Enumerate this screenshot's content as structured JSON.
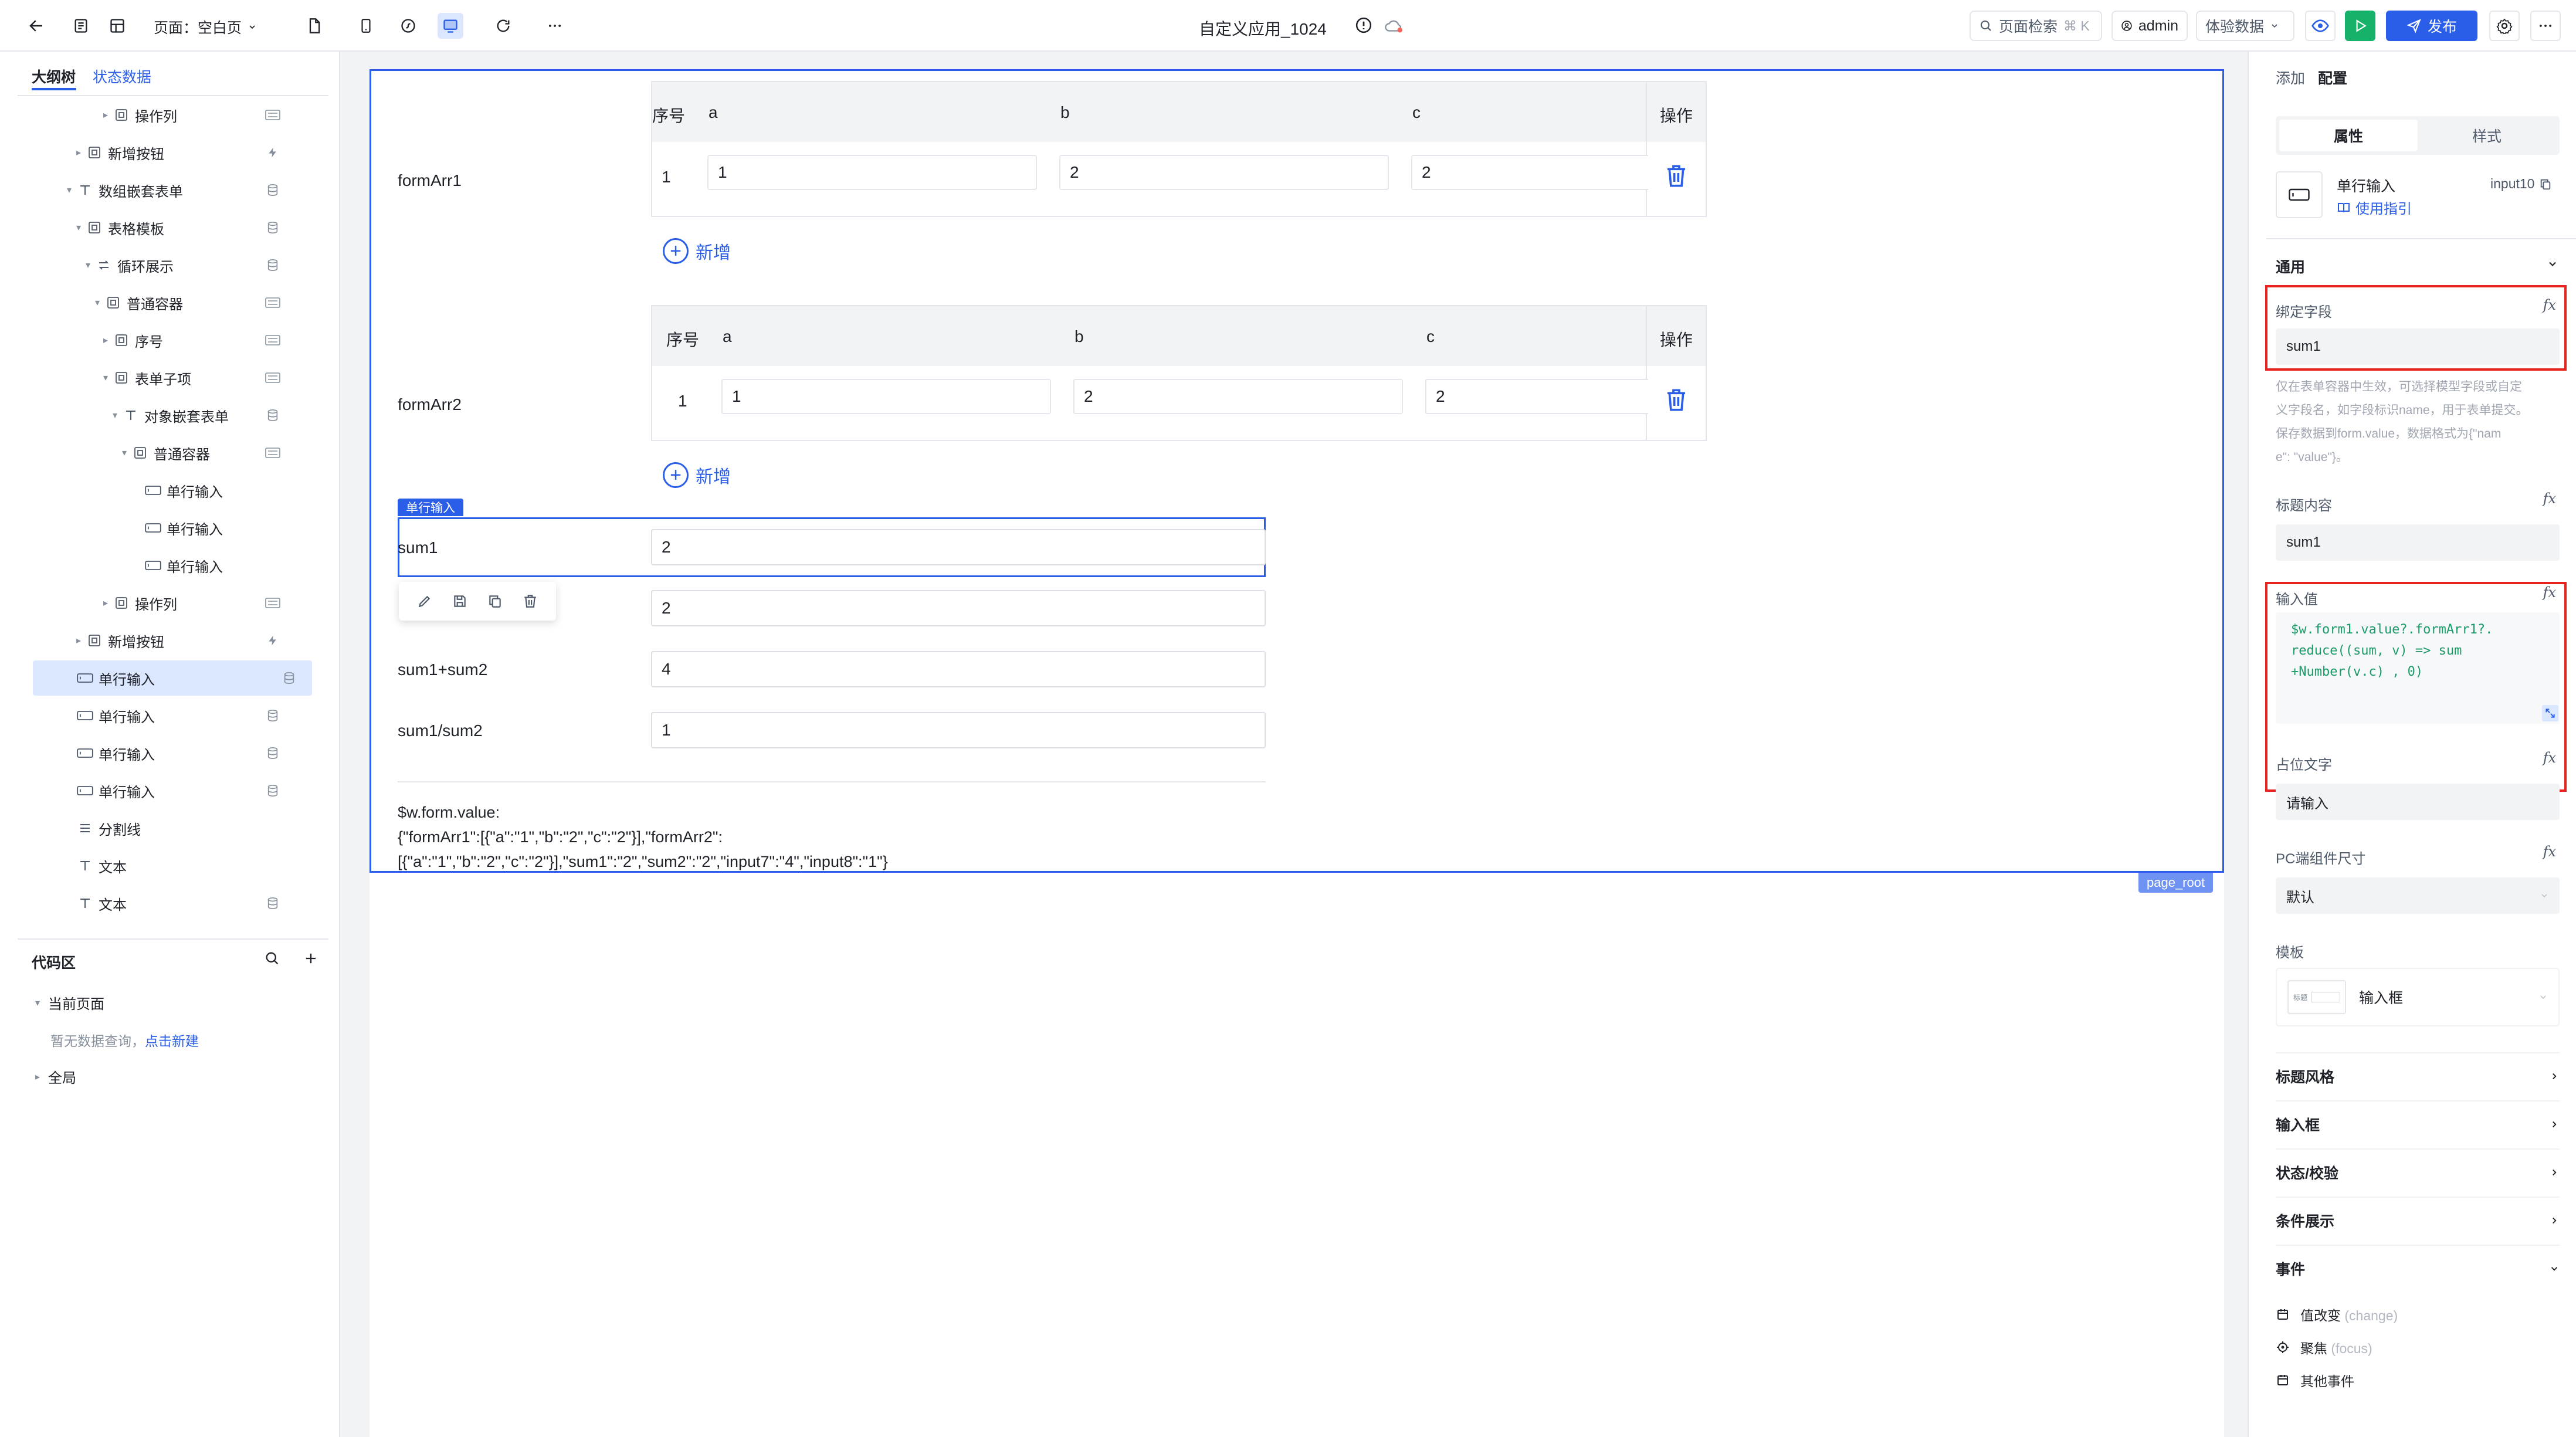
{
  "topbar": {
    "page_label": "页面：空白页",
    "app_title": "自定义应用_1024",
    "search": {
      "label": "页面检索",
      "shortcut": "⌘ K"
    },
    "user": "admin",
    "experience_data": "体验数据",
    "publish": "发布"
  },
  "left": {
    "tabs": [
      "大纲树",
      "状态数据"
    ],
    "tree": [
      {
        "label": "操作列"
      },
      {
        "label": "新增按钮"
      },
      {
        "label": "数组嵌套表单"
      },
      {
        "label": "表格模板"
      },
      {
        "label": "循环展示"
      },
      {
        "label": "普通容器"
      },
      {
        "label": "序号"
      },
      {
        "label": "表单子项"
      },
      {
        "label": "对象嵌套表单"
      },
      {
        "label": "普通容器"
      },
      {
        "label": "单行输入"
      },
      {
        "label": "单行输入"
      },
      {
        "label": "单行输入"
      },
      {
        "label": "操作列"
      },
      {
        "label": "新增按钮"
      },
      {
        "label": "单行输入"
      },
      {
        "label": "单行输入"
      },
      {
        "label": "单行输入"
      },
      {
        "label": "单行输入"
      },
      {
        "label": "分割线"
      },
      {
        "label": "文本"
      },
      {
        "label": "文本"
      }
    ],
    "code_area": {
      "title": "代码区",
      "current_page": "当前页面",
      "empty_hint": "暂无数据查询，",
      "create_link": "点击新建",
      "global": "全局"
    }
  },
  "canvas": {
    "page_tag": "page_root",
    "formArr1": {
      "label": "formArr1",
      "headers": [
        "序号",
        "a",
        "b",
        "c",
        "操作"
      ],
      "row": {
        "index": "1",
        "a": "1",
        "b": "2",
        "c": "2"
      },
      "add": "新增"
    },
    "formArr2": {
      "label": "formArr2",
      "headers": [
        "序号",
        "a",
        "b",
        "c",
        "操作"
      ],
      "row": {
        "index": "1",
        "a": "1",
        "b": "2",
        "c": "2"
      },
      "add": "新增"
    },
    "selected_tag": "单行输入",
    "fields": [
      {
        "label": "sum1",
        "value": "2"
      },
      {
        "label": "",
        "value": "2"
      },
      {
        "label": "sum1+sum2",
        "value": "4"
      },
      {
        "label": "sum1/sum2",
        "value": "1"
      }
    ],
    "form_value_title": "$w.form.value:",
    "form_value_line1": "{\"formArr1\":[{\"a\":\"1\",\"b\":\"2\",\"c\":\"2\"}],\"formArr2\":",
    "form_value_line2": "[{\"a\":\"1\",\"b\":\"2\",\"c\":\"2\"}],\"sum1\":\"2\",\"sum2\":\"2\",\"input7\":\"4\",\"input8\":\"1\"}"
  },
  "right": {
    "tabs": [
      "添加",
      "配置"
    ],
    "subtabs": [
      "属性",
      "样式"
    ],
    "component": {
      "name": "单行输入",
      "id": "input10",
      "guide": "使用指引"
    },
    "general": "通用",
    "bind_field": {
      "label": "绑定字段",
      "value": "sum1"
    },
    "bind_hint_lines": [
      "仅在表单容器中生效，可选择模型字段或自定",
      "义字段名，如字段标识name，用于表单提交。",
      "保存数据到form.value，数据格式为{\"nam",
      "e\": \"value\"}。"
    ],
    "title_content": {
      "label": "标题内容",
      "value": "sum1"
    },
    "input_value": {
      "label": "输入值",
      "code_lines": [
        "$w.form1.value?.formArr1?.",
        "reduce((sum, v) => sum",
        "+Number(v.c) , 0)"
      ]
    },
    "placeholder": {
      "label": "占位文字",
      "value": "请输入"
    },
    "pc_size": {
      "label": "PC端组件尺寸",
      "value": "默认"
    },
    "template": {
      "label": "模板",
      "value": "输入框",
      "thumb_text": "标题"
    },
    "collapsed_sections": [
      "标题风格",
      "输入框",
      "状态/校验",
      "条件展示"
    ],
    "events": {
      "title": "事件",
      "items": [
        {
          "label": "值改变",
          "hint": "(change)"
        },
        {
          "label": "聚焦",
          "hint": "(focus)"
        },
        {
          "label": "其他事件",
          "hint": ""
        }
      ]
    }
  },
  "colors": {
    "accent": "#2a5ee8",
    "highlight": "#e8231d",
    "selected_bg": "#dbe6ff"
  }
}
